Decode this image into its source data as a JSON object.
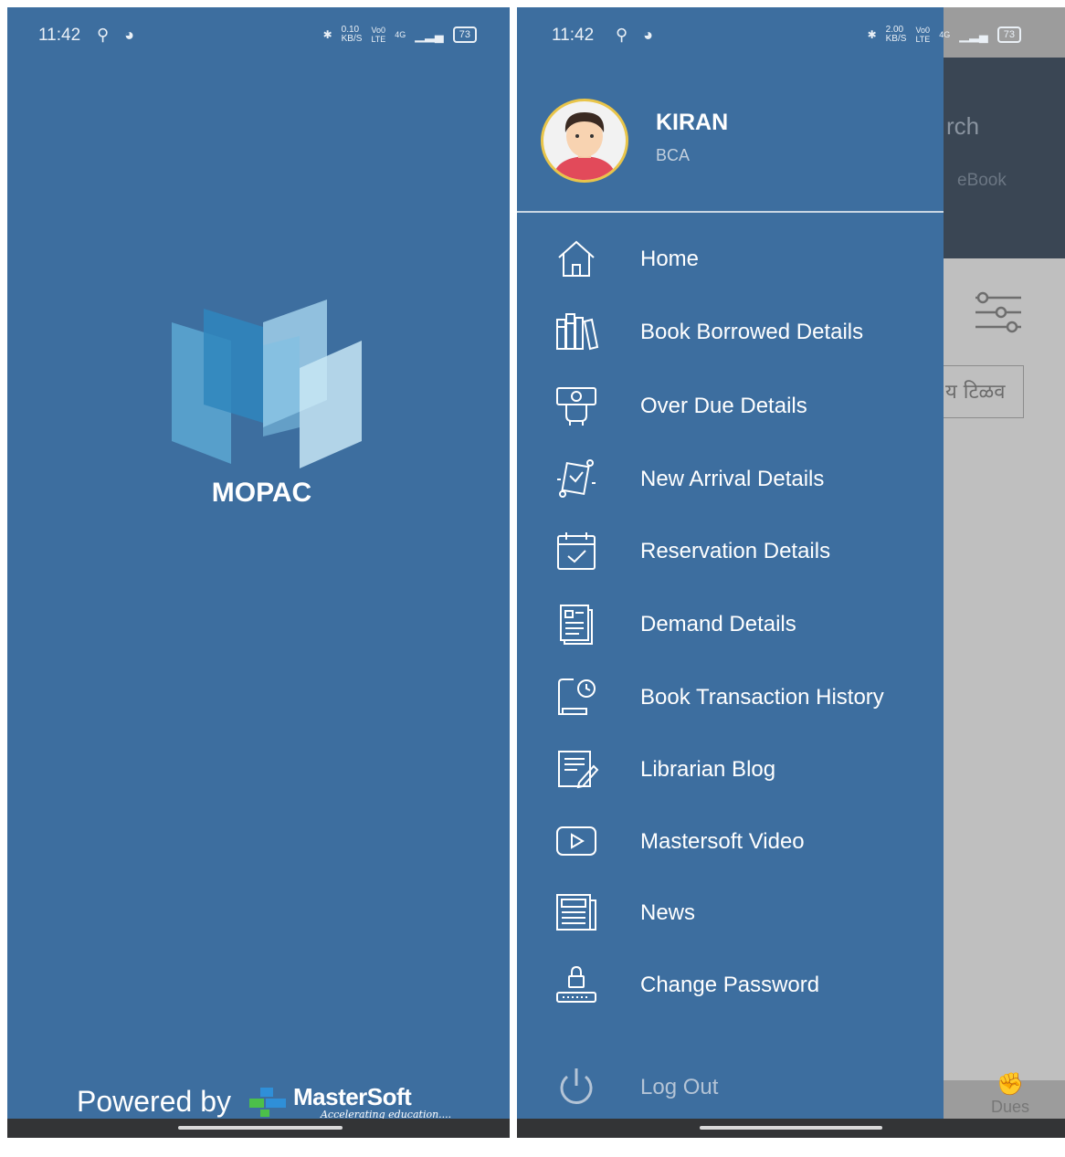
{
  "left_screen": {
    "status_bar": {
      "time": "11:42",
      "left_icons": "⚲ ◕",
      "network_speed": "0.10\nKB/S",
      "volte": "Vo0\nLTE",
      "net_type": "4G",
      "battery": "73"
    },
    "app_name": "MOPAC",
    "powered_by": "Powered by",
    "vendor_name": "MasterSoft",
    "vendor_tagline": "Accelerating education...."
  },
  "right_screen": {
    "status_bar": {
      "time": "11:42",
      "network_speed": "2.00\nKB/S",
      "volte": "Vo0\nLTE",
      "net_type": "4G",
      "battery": "73"
    },
    "background": {
      "search_partial": "rch",
      "ebook_partial": "eBook",
      "marathi_partial": "य टिळव",
      "dues_label": "Dues"
    },
    "drawer": {
      "user_name": "KIRAN",
      "user_course": "BCA",
      "menu": [
        {
          "label": "Home",
          "icon": "home-icon"
        },
        {
          "label": "Book Borrowed Details",
          "icon": "books-icon"
        },
        {
          "label": "Over Due Details",
          "icon": "overdue-money-icon"
        },
        {
          "label": "New Arrival Details",
          "icon": "new-arrival-icon"
        },
        {
          "label": "Reservation Details",
          "icon": "calendar-check-icon"
        },
        {
          "label": "Demand Details",
          "icon": "demand-document-icon"
        },
        {
          "label": "Book Transaction History",
          "icon": "book-history-icon"
        },
        {
          "label": "Librarian Blog",
          "icon": "blog-icon"
        },
        {
          "label": "Mastersoft Video",
          "icon": "video-play-icon"
        },
        {
          "label": "News",
          "icon": "newspaper-icon"
        },
        {
          "label": "Change Password",
          "icon": "lock-password-icon"
        },
        {
          "label": "Log Out",
          "icon": "power-icon"
        }
      ]
    }
  },
  "colors": {
    "drawer_bg": "#3d6e9f",
    "avatar_ring": "#e9c54a"
  }
}
